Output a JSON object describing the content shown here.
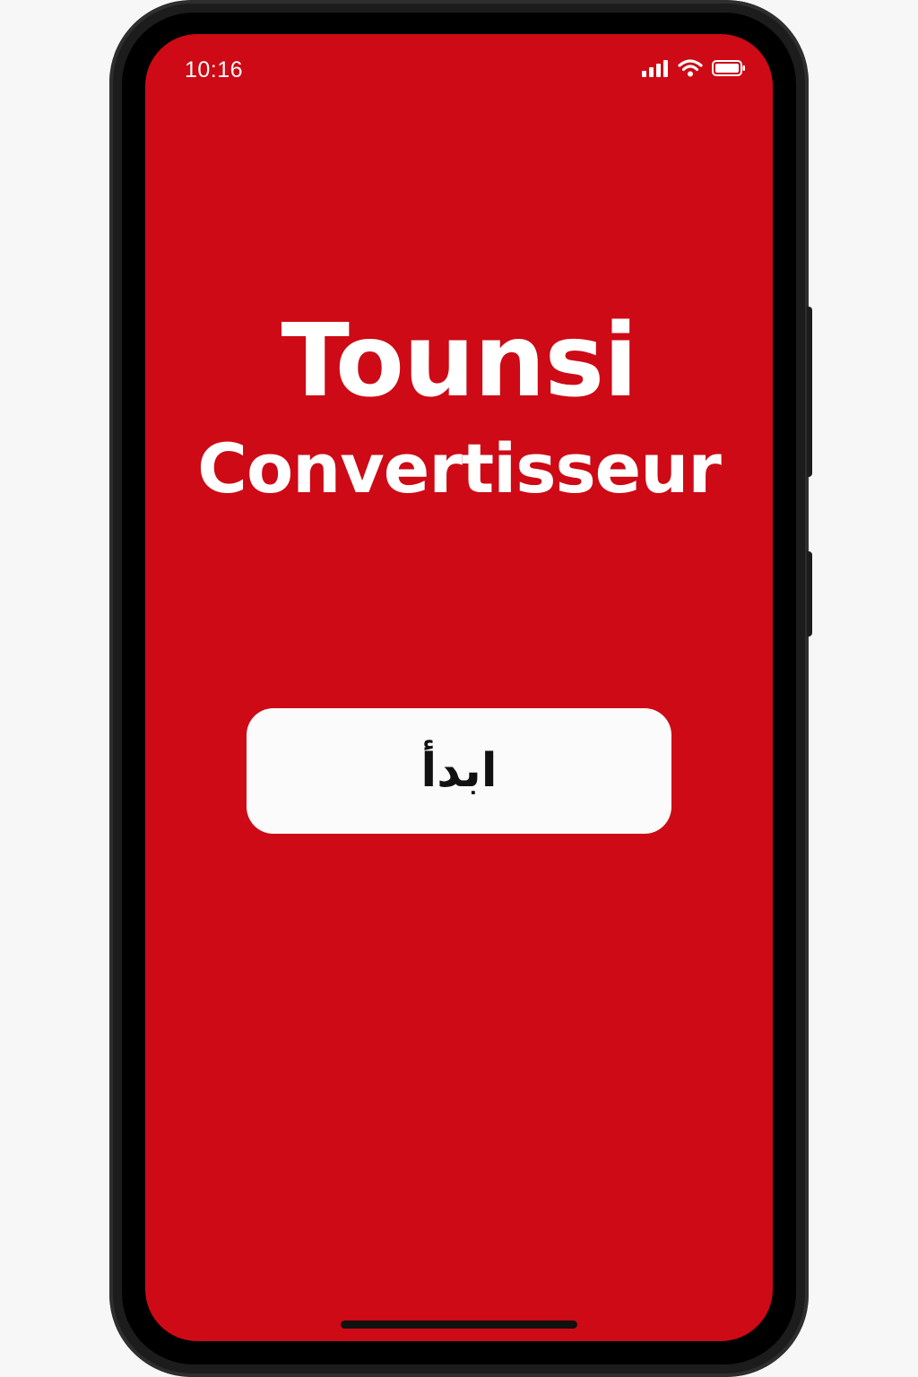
{
  "status_bar": {
    "time": "10:16",
    "icons": [
      "signal-icon",
      "wifi-icon",
      "battery-icon"
    ]
  },
  "app": {
    "title_line_1": "Tounsi",
    "title_line_2": "Convertisseur",
    "start_button_label": "ابدأ"
  },
  "colors": {
    "background": "#cd0a15",
    "title_text": "#ffffff",
    "button_background": "#fbfbfb",
    "button_text": "#111111",
    "device_frame": "#1c1c1c"
  }
}
